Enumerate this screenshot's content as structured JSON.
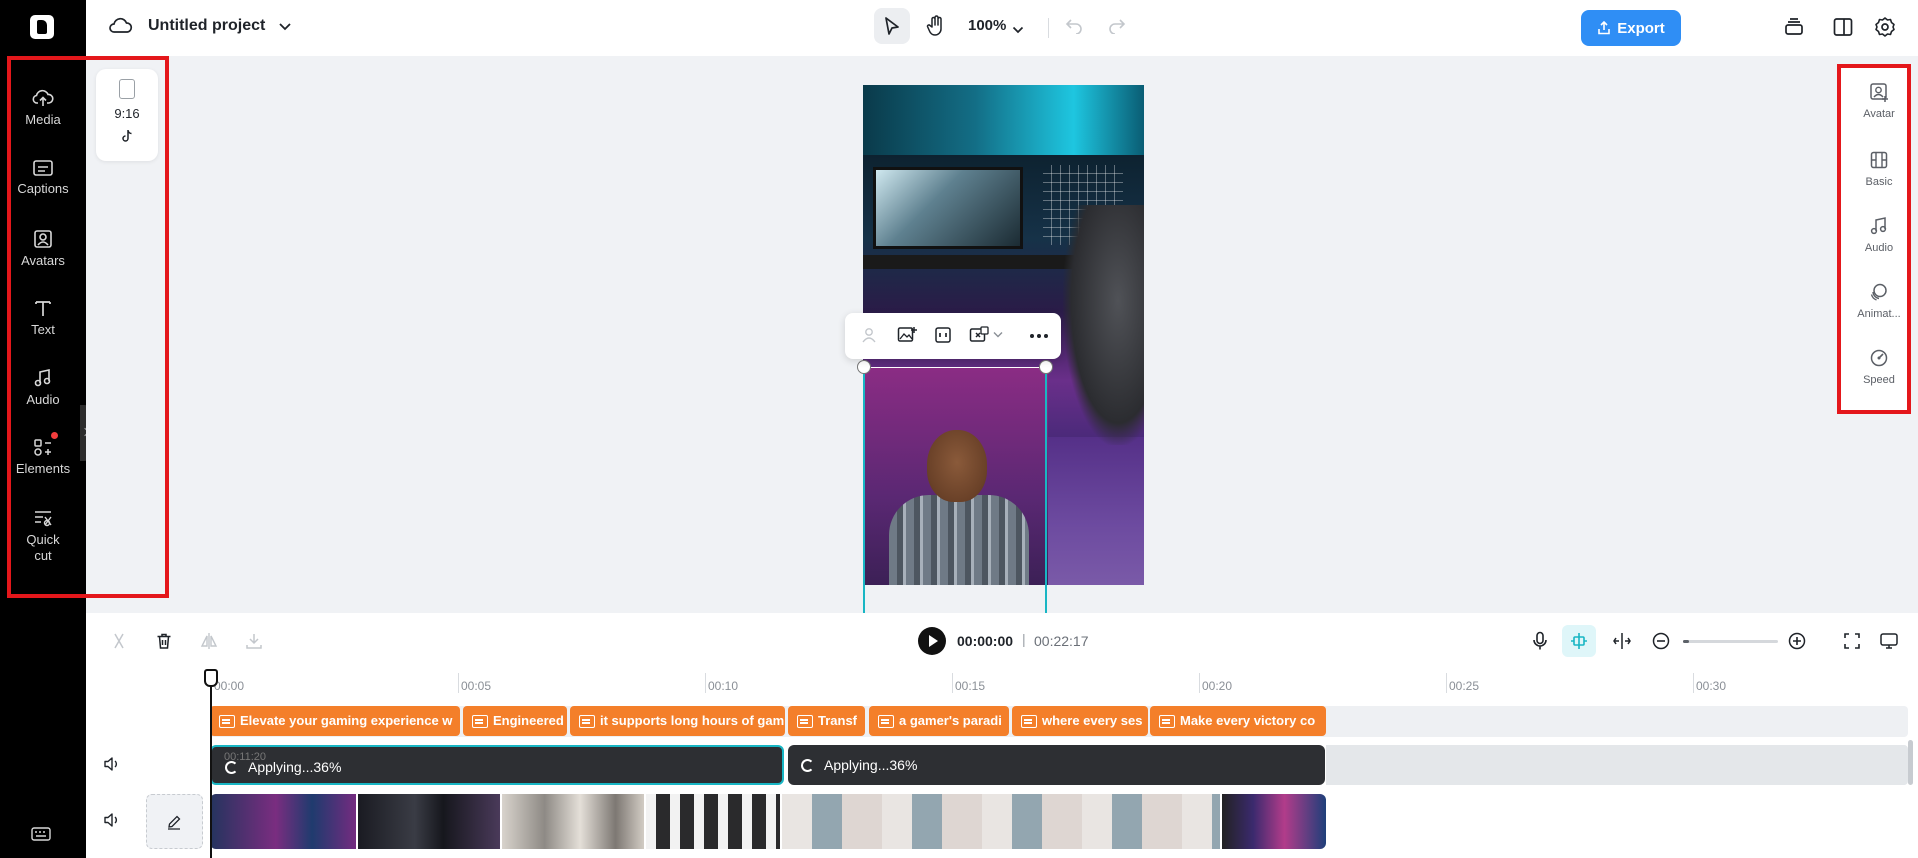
{
  "app": {
    "project_title": "Untitled project",
    "zoom_level": "100%",
    "export_label": "Export"
  },
  "left_rail": {
    "items": [
      {
        "label": "Media",
        "icon": "cloud-upload-icon"
      },
      {
        "label": "Captions",
        "icon": "captions-icon"
      },
      {
        "label": "Avatars",
        "icon": "avatar-icon"
      },
      {
        "label": "Text",
        "icon": "text-icon"
      },
      {
        "label": "Audio",
        "icon": "music-note-icon"
      },
      {
        "label": "Elements",
        "icon": "elements-icon"
      },
      {
        "label": "Quick cut",
        "icon": "quick-cut-icon"
      }
    ],
    "elements_badge_color": "#f23d3d"
  },
  "canvas": {
    "aspect_ratio": "9:16",
    "aspect_platform_icon": "tiktok-icon",
    "background_color": "#f0f2f5"
  },
  "right_panel": {
    "items": [
      {
        "label": "Avatar",
        "icon": "avatar-add-icon"
      },
      {
        "label": "Basic",
        "icon": "film-icon"
      },
      {
        "label": "Audio",
        "icon": "music-note-icon"
      },
      {
        "label": "Animat...",
        "icon": "animation-icon"
      },
      {
        "label": "Speed",
        "icon": "speedometer-icon"
      }
    ]
  },
  "highlight_color": "#e4171b",
  "playback": {
    "current_time": "00:00:00",
    "separator": "|",
    "total_time": "00:22:17",
    "timeline_zoom_fraction": 0.06
  },
  "timeline": {
    "ruler": [
      "00:00",
      "00:05",
      "00:10",
      "00:15",
      "00:20",
      "00:25",
      "00:30"
    ],
    "caption_clips": [
      "Elevate your gaming experience w",
      "Engineered",
      "it supports long hours of gam",
      "Transf",
      "a gamer's paradi",
      "where every ses",
      "Make every victory co"
    ],
    "audio_clips": [
      "Applying...36%",
      "Applying...36%"
    ],
    "audio_ghost_time": "00:11:20",
    "caption_color": "#f47f2a",
    "selection_color": "#18b6c4"
  }
}
